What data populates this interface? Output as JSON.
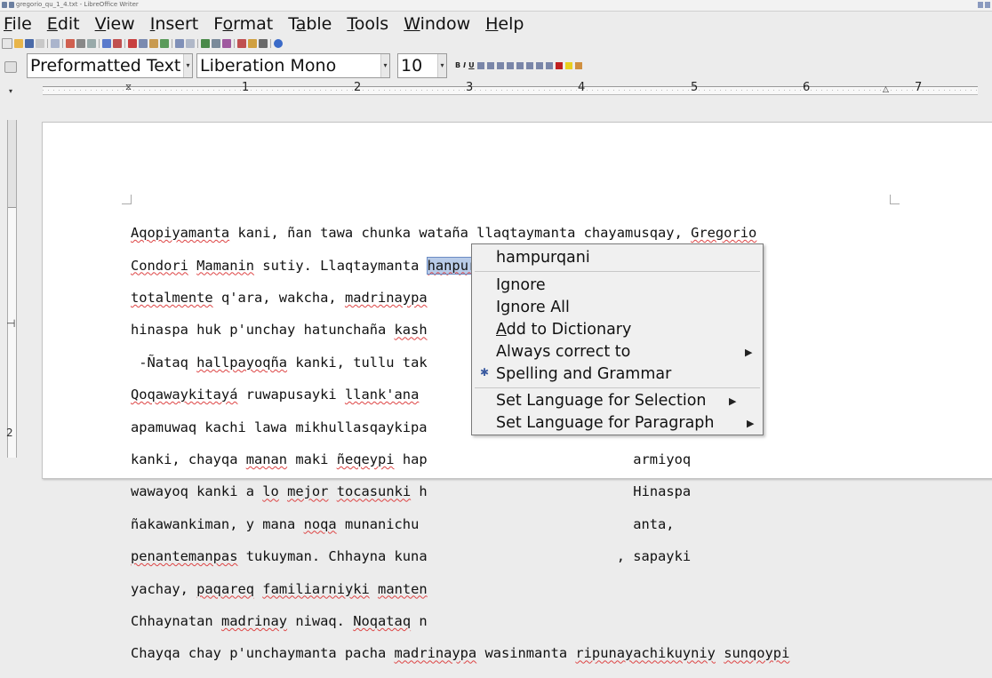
{
  "window": {
    "title": "gregorio_qu_1_4.txt - LibreOffice Writer"
  },
  "menu": [
    "File",
    "Edit",
    "View",
    "Insert",
    "Format",
    "Table",
    "Tools",
    "Window",
    "Help"
  ],
  "menu_underlines": [
    "F",
    "E",
    "V",
    "I",
    "o",
    "a",
    "T",
    "W",
    "H"
  ],
  "formatting": {
    "paragraph_style": "Preformatted Text",
    "font_name": "Liberation Mono",
    "font_size": "10"
  },
  "ruler": {
    "marks": [
      "1",
      "2",
      "3",
      "4",
      "5",
      "6",
      "7"
    ]
  },
  "document": {
    "lines": [
      "Aqopiyamanta kani, ñan tawa chunka wataña llaqtaymanta chayamusqay, Gregorio",
      "Condori Mamanin sutiy. Llaqtaymanta hanpurani mana mamay taytay kaqtin;",
      "totalmente q'ara, wakcha, madrinaypa                         ta rutuwaran,",
      "hinaspa huk p'unchay hatunchaña kash",
      " -Ñataq hallpayoqña kanki, tullu tak                         i.",
      "Qoqawaykitayá ruwapusayki llank'ana                          lqeta",
      "apamuwaq kachi lawa mikhullasqaykipa                         payoqña",
      "kanki, chayqa manan maki ñeqeypi hap                         armiyoq",
      "wawayoq kanki a lo mejor tocasunki h                         Hinaspa",
      "ñakawankiman, y mana noqa munanichu                          anta,",
      "penantemanpas tukuyman. Chhayna kuna                       , sapayki",
      "yachay, paqareq familiarniyki manten",
      "Chhaynatan madrinay niwaq. Noqataq n",
      "Chayqa chay p'unchaymanta pacha madrinaypa wasinmanta ripunayachikuyniy sunqoypi"
    ],
    "selected_word": "hanpurani"
  },
  "context_menu": {
    "suggestion": "hampurqani",
    "ignore": "Ignore",
    "ignore_all": "Ignore All",
    "add_to_dictionary": "Add to Dictionary",
    "always_correct_to": "Always correct to",
    "spelling_and_grammar": "Spelling and Grammar",
    "set_language_selection": "Set Language for Selection",
    "set_language_paragraph": "Set Language for Paragraph"
  }
}
